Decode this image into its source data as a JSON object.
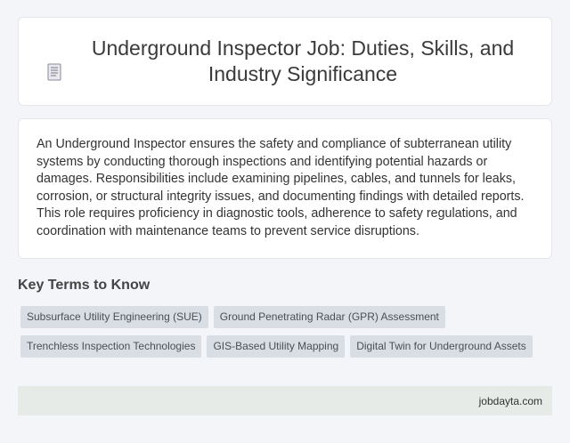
{
  "header": {
    "title": "Underground Inspector Job: Duties, Skills, and Industry Significance",
    "icon": "document-icon"
  },
  "description": "An Underground Inspector ensures the safety and compliance of subterranean utility systems by conducting thorough inspections and identifying potential hazards or damages. Responsibilities include examining pipelines, cables, and tunnels for leaks, corrosion, or structural integrity issues, and documenting findings with detailed reports. This role requires proficiency in diagnostic tools, adherence to safety regulations, and coordination with maintenance teams to prevent service disruptions.",
  "key_terms": {
    "heading": "Key Terms to Know",
    "tags": [
      "Subsurface Utility Engineering (SUE)",
      "Ground Penetrating Radar (GPR) Assessment",
      "Trenchless Inspection Technologies",
      "GIS-Based Utility Mapping",
      "Digital Twin for Underground Assets"
    ]
  },
  "footer": {
    "site": "jobdayta.com"
  },
  "colors": {
    "background": "#f3f5f8",
    "card": "#ffffff",
    "tag_bg": "#d9dee4",
    "footer_bg": "#e6ebe8"
  }
}
